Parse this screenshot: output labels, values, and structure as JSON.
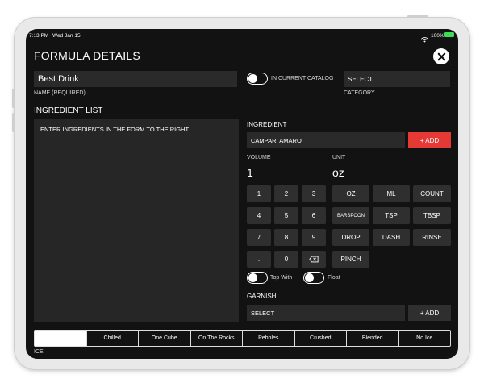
{
  "status": {
    "time": "7:13 PM",
    "date": "Wed Jan 15",
    "battery": "100%"
  },
  "header": {
    "title": "FORMULA DETAILS"
  },
  "name": {
    "value": "Best Drink",
    "label": "NAME (REQUIRED)"
  },
  "catalog": {
    "label": "IN CURRENT CATALOG",
    "on": false
  },
  "category": {
    "value": "SELECT",
    "label": "CATEGORY"
  },
  "ingredient_list": {
    "heading": "INGREDIENT LIST",
    "placeholder": "ENTER INGREDIENTS IN THE FORM TO THE RIGHT"
  },
  "ingredient": {
    "heading": "INGREDIENT",
    "value": "CAMPARI AMARO",
    "add_label": "+ ADD"
  },
  "volume": {
    "label": "VOLUME",
    "value": "1"
  },
  "unit": {
    "label": "UNIT",
    "value": "oz"
  },
  "keypad": {
    "keys": [
      "1",
      "2",
      "3",
      "4",
      "5",
      "6",
      "7",
      "8",
      "9",
      ".",
      "0"
    ]
  },
  "units": {
    "rows": [
      [
        "OZ",
        "ML",
        "COUNT"
      ],
      [
        "BARSPOON",
        "TSP",
        "TBSP"
      ],
      [
        "DROP",
        "DASH",
        "RINSE"
      ],
      [
        "PINCH"
      ]
    ]
  },
  "toggles": {
    "top_with": "Top With",
    "float": "Float"
  },
  "garnish": {
    "heading": "GARNISH",
    "value": "SELECT",
    "add_label": "+ ADD"
  },
  "ice": {
    "label": "ICE",
    "options": [
      "",
      "Chilled",
      "One Cube",
      "On The Rocks",
      "Pebbles",
      "Crushed",
      "Blended",
      "No Ice"
    ]
  },
  "colors": {
    "accent": "#e53935",
    "background": "#121212",
    "field": "#2a2a2a",
    "button": "#2f2f2f"
  }
}
